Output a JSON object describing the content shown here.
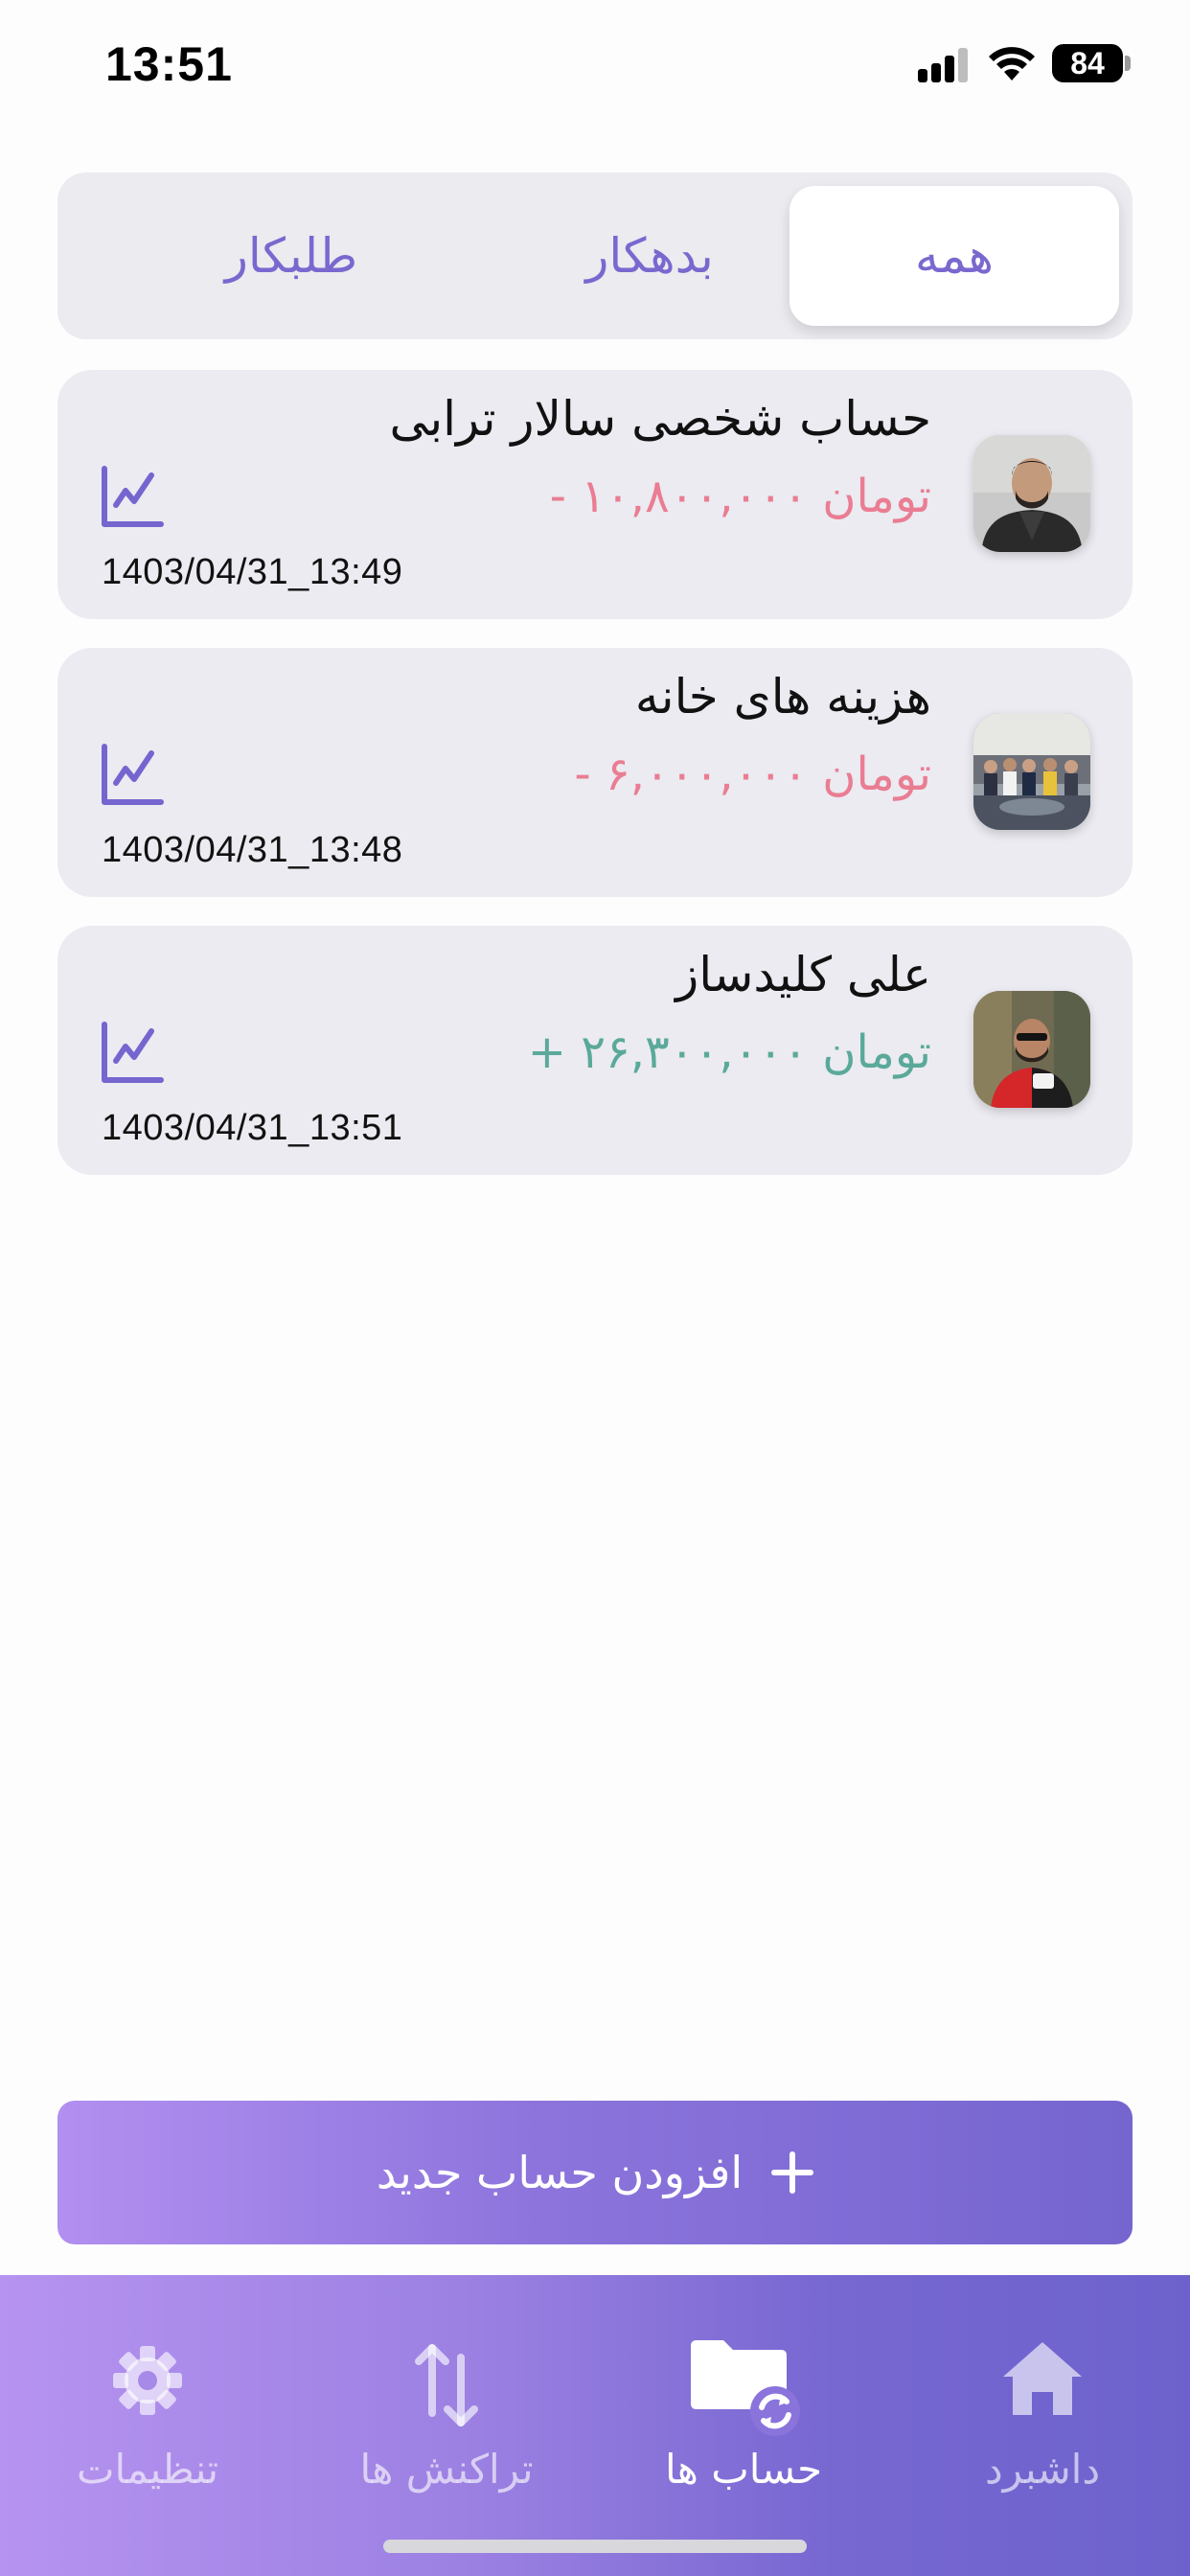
{
  "status_bar": {
    "time": "13:51",
    "battery": "84",
    "icons": [
      "signal-icon",
      "wifi-icon",
      "battery-icon"
    ]
  },
  "filter_tabs": [
    {
      "label": "همه",
      "selected": true
    },
    {
      "label": "بدهکار",
      "selected": false
    },
    {
      "label": "طلبکار",
      "selected": false
    }
  ],
  "accounts": [
    {
      "name": "حساب شخصی سالار ترابی",
      "amount": "- ۱۰,۸۰۰,۰۰۰ تومان",
      "direction": "negative",
      "date": "1403/04/31_13:49",
      "icon": "chart-icon"
    },
    {
      "name": "هزینه های خانه",
      "amount": "- ۶,۰۰۰,۰۰۰ تومان",
      "direction": "negative",
      "date": "1403/04/31_13:48",
      "icon": "chart-icon"
    },
    {
      "name": "علی کلیدساز",
      "amount": "+ ۲۶,۳۰۰,۰۰۰ تومان",
      "direction": "positive",
      "date": "1403/04/31_13:51",
      "icon": "chart-icon"
    }
  ],
  "add_button": {
    "label": "افزودن حساب جدید",
    "icon": "plus-icon"
  },
  "bottom_nav": [
    {
      "label": "تنظیمات",
      "icon": "gear-icon",
      "active": false
    },
    {
      "label": "تراکنش ها",
      "icon": "transfer-arrows-icon",
      "active": false
    },
    {
      "label": "حساب ها",
      "icon": "folder-sync-icon",
      "active": true
    },
    {
      "label": "داشبرد",
      "icon": "home-icon",
      "active": false
    }
  ],
  "colors": {
    "accent": "#7565cf",
    "negative": "#ea7d92",
    "positive": "#5aa99a",
    "card_bg": "#ebebf1"
  }
}
